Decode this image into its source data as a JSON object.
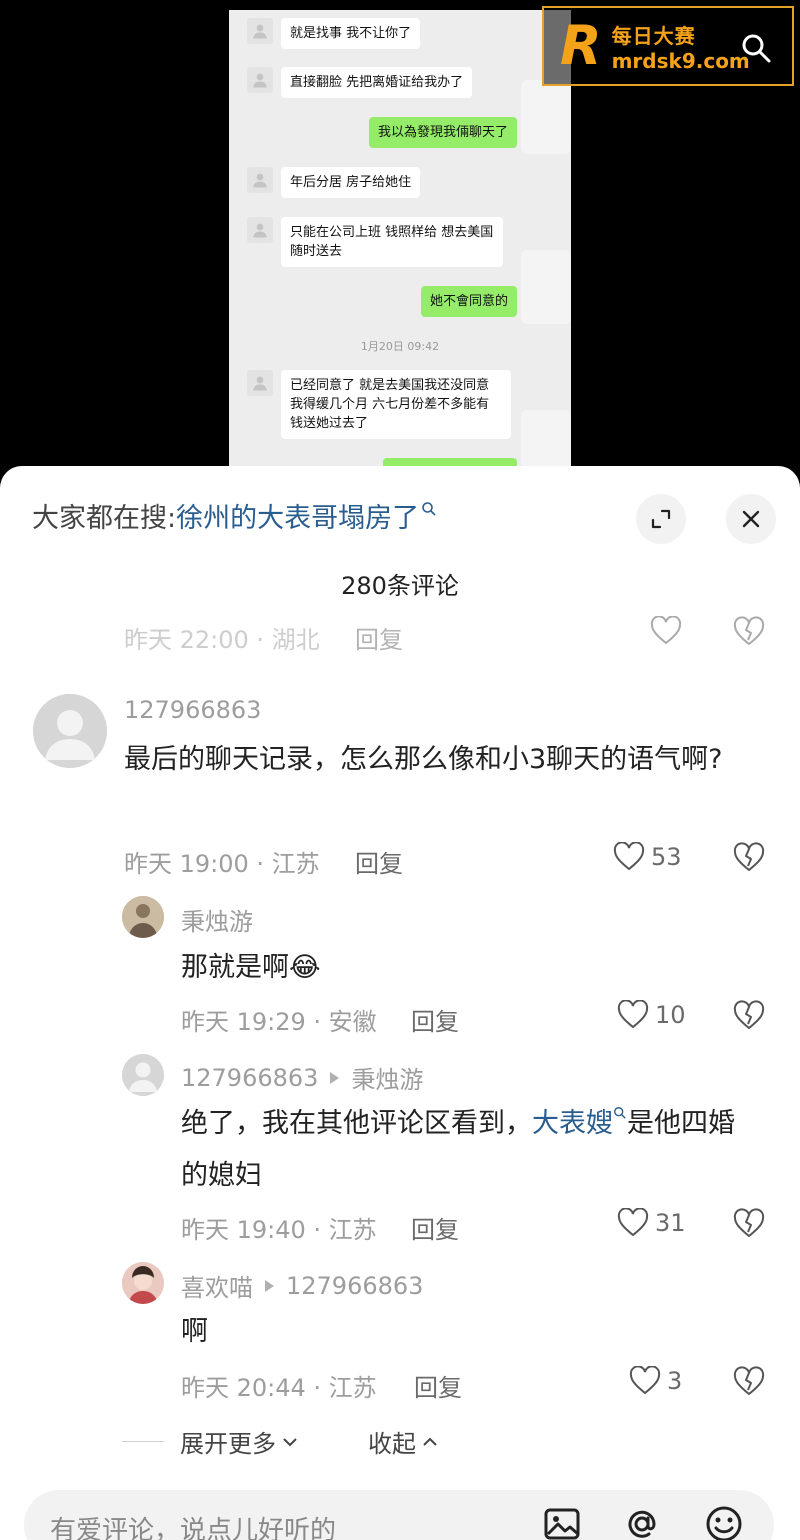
{
  "video": {
    "chat": [
      {
        "side": "left",
        "text": "就是找事 我不让你了"
      },
      {
        "side": "left",
        "text": "直接翻脸 先把离婚证给我办了"
      },
      {
        "side": "right",
        "text": "我以為發現我倆聊天了"
      },
      {
        "side": "left",
        "text": "年后分居 房子给她住"
      },
      {
        "side": "left",
        "text": "只能在公司上班 钱照样给 想去美国随时送去"
      },
      {
        "side": "right",
        "text": "她不會同意的"
      },
      {
        "side": "left",
        "text": "已经同意了 就是去美国我还没同意 我得缓几个月 六七月份差不多能有钱送她过去了"
      }
    ],
    "timestamp": "1月20日 09:42"
  },
  "watermark": {
    "letter": "R",
    "name": "每日大赛",
    "domain": "mrdsk9.com",
    "color": "#f4a21a"
  },
  "panel": {
    "search_prefix": "大家都在搜:",
    "search_link": "徐州的大表哥塌房了",
    "comment_count": "280条评论",
    "partial_meta": "昨天 22:00 · 湖北",
    "partial_reply": "回复",
    "comments": [
      {
        "user": "127966863",
        "text": "最后的聊天记录，怎么那么像和小3聊天的语气啊?",
        "meta": "昨天 19:00 · 江苏",
        "reply": "回复",
        "likes": "53"
      },
      {
        "user": "秉烛游",
        "text": "那就是啊😂",
        "meta": "昨天 19:29 · 安徽",
        "reply": "回复",
        "likes": "10"
      },
      {
        "user": "127966863",
        "reply_to": "秉烛游",
        "text_before": "绝了，我在其他评论区看到，",
        "text_link": "大表嫂",
        "text_after": "是他四婚的媳妇",
        "meta": "昨天 19:40 · 江苏",
        "reply": "回复",
        "likes": "31"
      },
      {
        "user": "喜欢喵",
        "reply_to": "127966863",
        "text": "啊",
        "meta": "昨天 20:44 · 江苏",
        "reply": "回复",
        "likes": "3"
      }
    ],
    "expand_more": "展开更多",
    "collapse": "收起",
    "input_placeholder": "有爱评论，说点儿好听的"
  },
  "colors": {
    "link": "#2a5d8f",
    "accent": "#f4a21a",
    "bubble_me": "#95ec69"
  },
  "icons": [
    "search-icon",
    "expand-icon",
    "close-icon",
    "heart-icon",
    "broken-heart-icon",
    "image-icon",
    "at-icon",
    "emoji-icon",
    "chevron-down-icon",
    "chevron-up-icon"
  ]
}
